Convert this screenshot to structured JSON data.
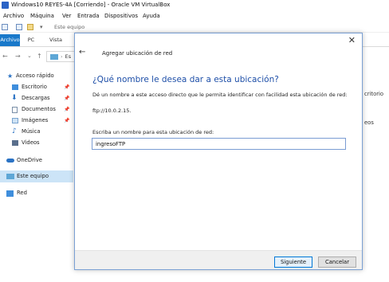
{
  "vbox": {
    "title": "Windows10 REYES-4A [Corriendo] - Oracle VM VirtualBox",
    "menu": [
      "Archivo",
      "Máquina",
      "Ver",
      "Entrada",
      "Dispositivos",
      "Ayuda"
    ]
  },
  "explorer": {
    "qat_text": "Este equipo",
    "ribbon_tabs": [
      "Archivo",
      "PC",
      "Vista"
    ],
    "address_text": "Es",
    "nav": {
      "back": "←",
      "forward": "→",
      "recent": "⌄",
      "up": "↑"
    },
    "sidebar": [
      {
        "label": "Acceso rápido",
        "icon": "star-icon",
        "pinned": false
      },
      {
        "label": "Escritorio",
        "icon": "desktop-folder-icon",
        "pinned": true
      },
      {
        "label": "Descargas",
        "icon": "download-icon",
        "pinned": true
      },
      {
        "label": "Documentos",
        "icon": "documents-icon",
        "pinned": true
      },
      {
        "label": "Imágenes",
        "icon": "pictures-icon",
        "pinned": true
      },
      {
        "label": "Música",
        "icon": "music-icon",
        "pinned": false
      },
      {
        "label": "Videos",
        "icon": "videos-icon",
        "pinned": false
      },
      {
        "label": "OneDrive",
        "icon": "cloud-icon",
        "pinned": false
      },
      {
        "label": "Este equipo",
        "icon": "computer-icon",
        "pinned": false,
        "selected": true
      },
      {
        "label": "Red",
        "icon": "network-icon",
        "pinned": false
      }
    ],
    "right_items": [
      "critorio",
      "eos"
    ]
  },
  "dialog": {
    "close": "✕",
    "back": "←",
    "wizard_title": "Agregar ubicación de red",
    "heading": "¿Qué nombre le desea dar a esta ubicación?",
    "description": "Dé un nombre a este acceso directo que le permita identificar con facilidad esta ubicación de red:",
    "url": "ftp://10.0.2.15.",
    "name_label": "Escriba un nombre para esta ubicación de red:",
    "name_value": "ingresoFTP",
    "next_button": "Siguiente",
    "cancel_button": "Cancelar"
  },
  "colors": {
    "accent": "#1979ca",
    "heading": "#1e4fa8",
    "selected": "#cce4f7"
  }
}
